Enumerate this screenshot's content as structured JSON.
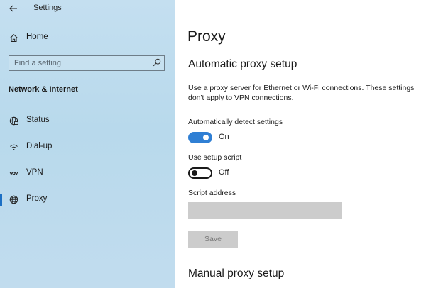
{
  "app": {
    "title": "Settings",
    "back_icon": "arrow-left-icon"
  },
  "sidebar": {
    "home": {
      "label": "Home",
      "icon": "home-icon"
    },
    "search": {
      "placeholder": "Find a setting",
      "value": "",
      "icon": "search-icon"
    },
    "section_heading": "Network & Internet",
    "items": [
      {
        "label": "Status",
        "icon": "globe-status-icon",
        "selected": false
      },
      {
        "label": "Dial-up",
        "icon": "dialup-icon",
        "selected": false
      },
      {
        "label": "VPN",
        "icon": "vpn-icon",
        "selected": false
      },
      {
        "label": "Proxy",
        "icon": "globe-icon",
        "selected": true
      }
    ]
  },
  "main": {
    "page_title": "Proxy",
    "automatic": {
      "title": "Automatic proxy setup",
      "description": "Use a proxy server for Ethernet or Wi-Fi connections. These settings don't apply to VPN connections.",
      "detect": {
        "label": "Automatically detect settings",
        "state": "On",
        "checked": true
      },
      "script": {
        "label": "Use setup script",
        "state": "Off",
        "checked": false
      },
      "address": {
        "label": "Script address",
        "value": ""
      },
      "save_label": "Save"
    },
    "manual": {
      "title": "Manual proxy setup"
    }
  },
  "colors": {
    "accent": "#2f7fd4",
    "selection_bar": "#1c6fc4",
    "sidebar_bg": "#bcdaec",
    "disabled_fill": "#cccccc"
  }
}
